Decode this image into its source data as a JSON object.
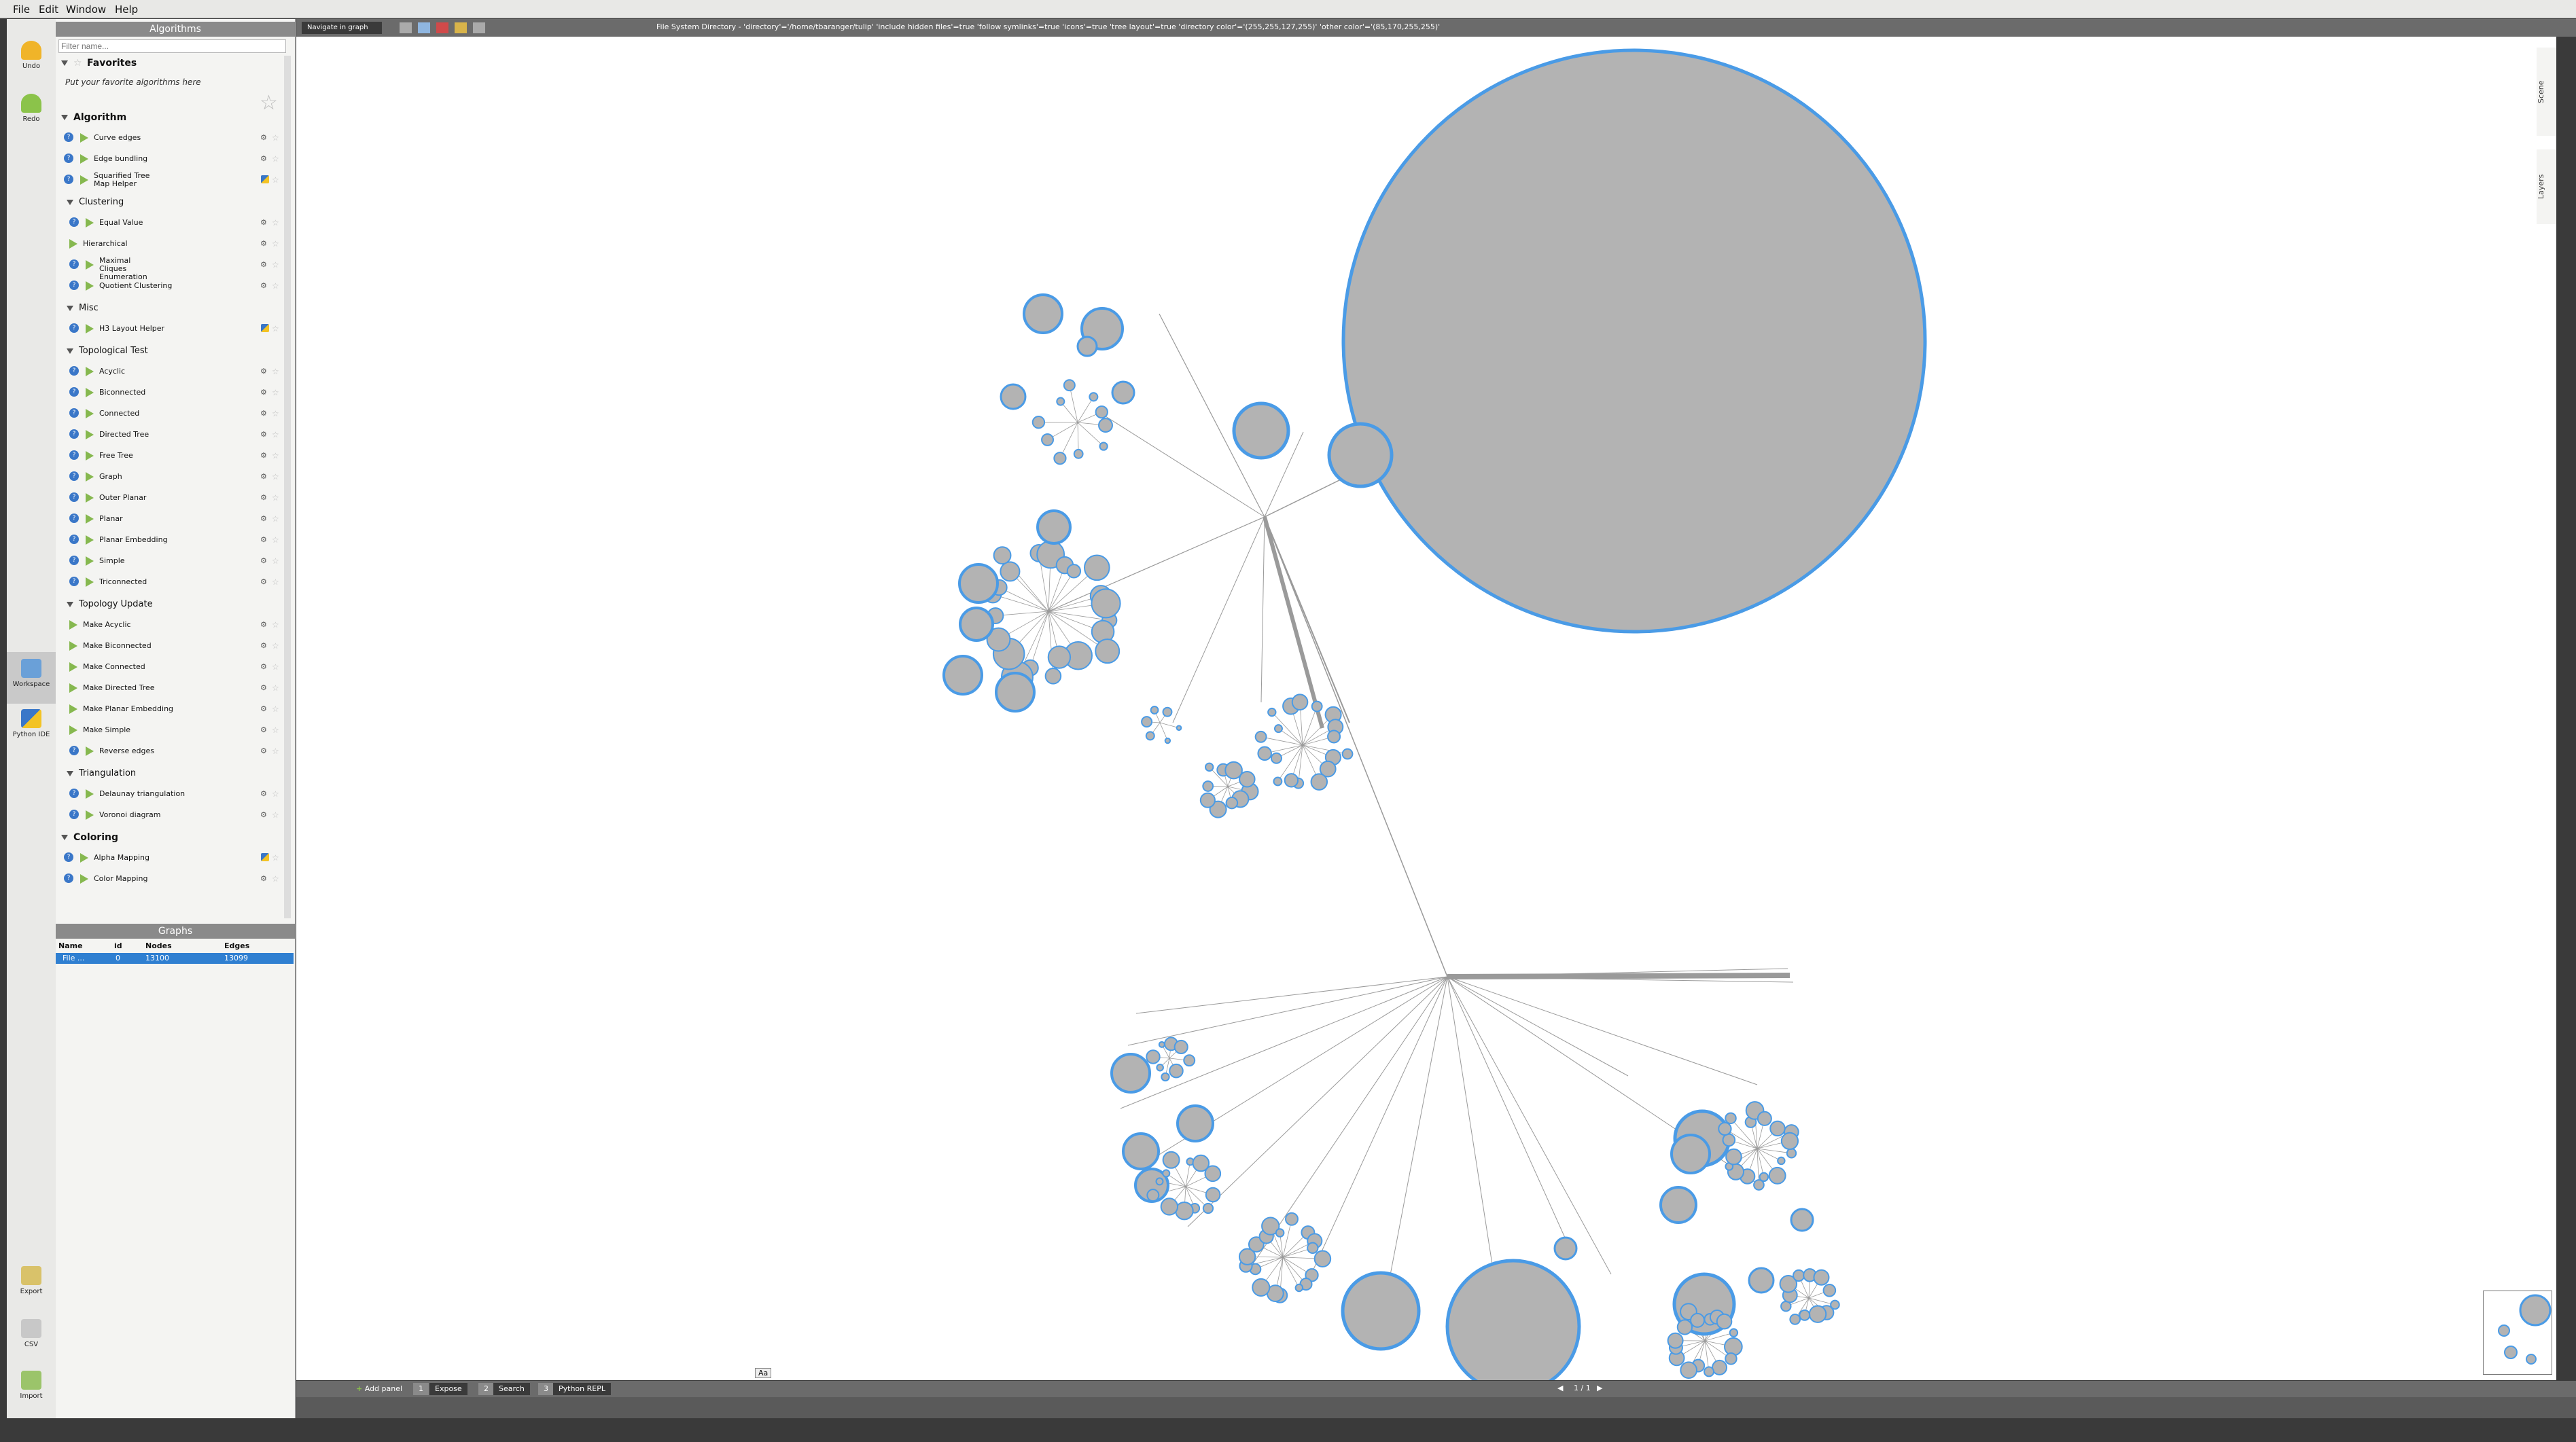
{
  "menu": [
    "File",
    "Edit",
    "Window",
    "Help"
  ],
  "toolstrip": {
    "undo": "Undo",
    "redo": "Redo",
    "workspace": "Workspace",
    "python_ide": "Python IDE",
    "export": "Export",
    "csv": "CSV",
    "import": "Import"
  },
  "algorithms_panel": {
    "title": "Algorithms",
    "filter_placeholder": "Filter name...",
    "favorites": "Favorites",
    "favorites_hint": "Put your favorite algorithms here",
    "sections": [
      {
        "name": "Algorithm",
        "items": [
          "Curve edges",
          "Edge bundling",
          "Squarified Tree Map Helper"
        ]
      },
      {
        "name": "Clustering",
        "items": [
          "Equal Value",
          "Hierarchical",
          "Maximal Cliques Enumeration",
          "Quotient Clustering"
        ]
      },
      {
        "name": "Misc",
        "items": [
          "H3 Layout Helper"
        ]
      },
      {
        "name": "Topological Test",
        "items": [
          "Acyclic",
          "Biconnected",
          "Connected",
          "Directed Tree",
          "Free Tree",
          "Graph",
          "Outer Planar",
          "Planar",
          "Planar Embedding",
          "Simple",
          "Triconnected"
        ]
      },
      {
        "name": "Topology Update",
        "items": [
          "Make Acyclic",
          "Make Biconnected",
          "Make Connected",
          "Make Directed Tree",
          "Make Planar Embedding",
          "Make Simple",
          "Reverse edges"
        ]
      },
      {
        "name": "Triangulation",
        "items": [
          "Delaunay triangulation",
          "Voronoi diagram"
        ]
      },
      {
        "name": "Coloring",
        "items": [
          "Alpha Mapping",
          "Color Mapping"
        ]
      }
    ]
  },
  "graphs_panel": {
    "title": "Graphs",
    "headers": [
      "Name",
      "id",
      "Nodes",
      "Edges"
    ],
    "row": {
      "name": "File ...",
      "id": "0",
      "nodes": "13100",
      "edges": "13099"
    }
  },
  "view": {
    "nav_button": "Navigate in graph",
    "properties": "File System Directory - 'directory'='/home/tbaranger/tulip' 'include hidden files'=true 'follow symlinks'=true 'icons'=true 'tree layout'=true 'directory color'='(255,255,127,255)' 'other color'='(85,170,255,255)'",
    "scene_tab": "Scene",
    "layers_tab": "Layers",
    "page": "1 / 1",
    "font_btn": "Aa"
  },
  "bottombar": {
    "add_panel": "Add panel",
    "expose": "Expose",
    "search": "Search",
    "python_repl": "Python REPL",
    "n1": "1",
    "n2": "2",
    "n3": "3"
  },
  "colors": {
    "node_fill": "#b3b3b3",
    "node_stroke": "#4a9be6",
    "edge": "#9a9a9a",
    "accent": "#2f7fd1"
  }
}
